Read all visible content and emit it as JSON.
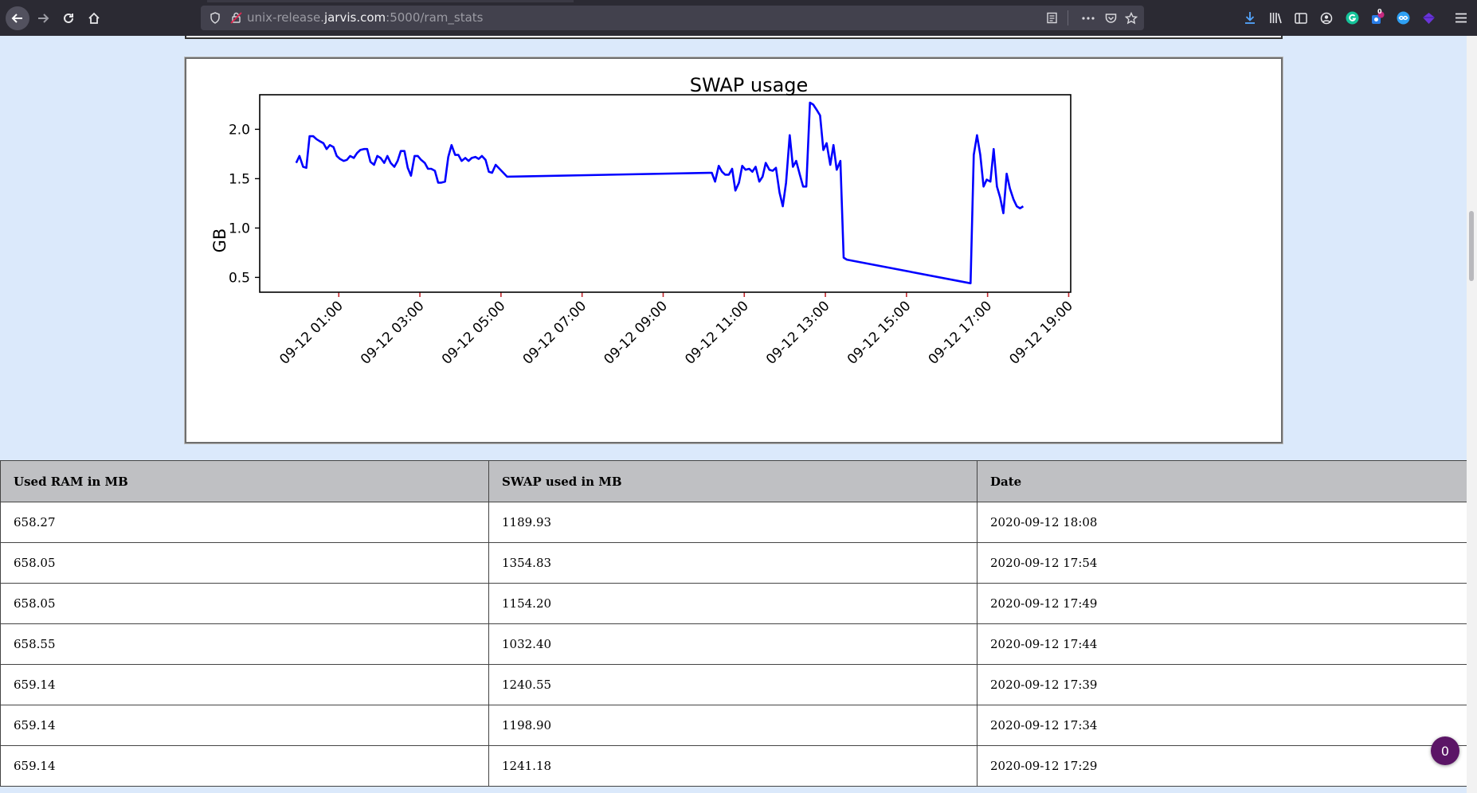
{
  "browser": {
    "url_prefix": "unix-release.",
    "url_domain": "jarvis.com",
    "url_suffix": ":5000/ram_stats",
    "notification_count": "0"
  },
  "colors": {
    "toolbar_bg": "#2b2a33",
    "page_bg": "#dbe9fb",
    "line": "#0000ff",
    "table_header_bg": "#bfc0c3",
    "badge_bg": "#5b1566"
  },
  "chart_data": {
    "type": "line",
    "title": "SWAP usage",
    "ylabel": "GB",
    "xlabel": "",
    "grid": false,
    "ylim": [
      0.35,
      2.35
    ],
    "yticks": [
      0.5,
      1.0,
      1.5,
      2.0
    ],
    "ytick_labels": [
      "0.5",
      "1.0",
      "1.5",
      "2.0"
    ],
    "xlim_hours": [
      -0.95,
      19.05
    ],
    "xtick_labels": [
      "09-12 01:00",
      "09-12 03:00",
      "09-12 05:00",
      "09-12 07:00",
      "09-12 09:00",
      "09-12 11:00",
      "09-12 13:00",
      "09-12 15:00",
      "09-12 17:00",
      "09-12 19:00"
    ],
    "xtick_hours": [
      1,
      3,
      5,
      7,
      9,
      11,
      13,
      15,
      17,
      19
    ],
    "x_hours": [
      -0.05,
      0.03,
      0.12,
      0.2,
      0.28,
      0.37,
      0.45,
      0.53,
      0.62,
      0.7,
      0.78,
      0.87,
      0.95,
      1.03,
      1.12,
      1.2,
      1.28,
      1.37,
      1.45,
      1.53,
      1.62,
      1.7,
      1.78,
      1.87,
      1.95,
      2.03,
      2.12,
      2.2,
      2.28,
      2.37,
      2.45,
      2.53,
      2.62,
      2.7,
      2.78,
      2.87,
      2.95,
      3.03,
      3.12,
      3.2,
      3.28,
      3.37,
      3.45,
      3.53,
      3.62,
      3.7,
      3.78,
      3.87,
      3.95,
      4.03,
      4.12,
      4.2,
      4.28,
      4.37,
      4.45,
      4.53,
      4.62,
      4.7,
      4.78,
      4.87,
      5.15,
      10.2,
      10.28,
      10.37,
      10.45,
      10.53,
      10.62,
      10.7,
      10.78,
      10.87,
      10.95,
      11.03,
      11.12,
      11.2,
      11.28,
      11.37,
      11.45,
      11.53,
      11.62,
      11.7,
      11.78,
      11.87,
      11.95,
      12.03,
      12.12,
      12.2,
      12.28,
      12.37,
      12.45,
      12.53,
      12.62,
      12.7,
      12.78,
      12.87,
      12.95,
      13.03,
      13.12,
      13.2,
      13.28,
      13.37,
      13.45,
      13.53,
      16.58,
      16.66,
      16.74,
      16.82,
      16.9,
      16.98,
      17.07,
      17.15,
      17.23,
      17.31,
      17.39,
      17.47,
      17.55,
      17.64,
      17.72,
      17.8,
      17.88
    ],
    "series": [
      {
        "values": [
          1.66,
          1.73,
          1.62,
          1.61,
          1.93,
          1.93,
          1.9,
          1.88,
          1.86,
          1.8,
          1.84,
          1.82,
          1.73,
          1.7,
          1.68,
          1.69,
          1.73,
          1.71,
          1.76,
          1.79,
          1.8,
          1.8,
          1.67,
          1.64,
          1.73,
          1.71,
          1.66,
          1.73,
          1.66,
          1.62,
          1.68,
          1.78,
          1.78,
          1.61,
          1.53,
          1.73,
          1.73,
          1.69,
          1.66,
          1.6,
          1.6,
          1.58,
          1.46,
          1.46,
          1.47,
          1.72,
          1.84,
          1.74,
          1.74,
          1.68,
          1.71,
          1.68,
          1.71,
          1.72,
          1.7,
          1.73,
          1.69,
          1.57,
          1.56,
          1.64,
          1.52,
          1.56,
          1.47,
          1.63,
          1.57,
          1.54,
          1.54,
          1.6,
          1.38,
          1.46,
          1.63,
          1.59,
          1.6,
          1.57,
          1.62,
          1.47,
          1.52,
          1.66,
          1.59,
          1.58,
          1.61,
          1.36,
          1.22,
          1.46,
          1.94,
          1.62,
          1.68,
          1.54,
          1.42,
          1.42,
          2.27,
          2.25,
          2.2,
          2.14,
          1.79,
          1.86,
          1.64,
          1.84,
          1.59,
          1.68,
          0.7,
          0.68,
          0.44,
          1.74,
          1.94,
          1.74,
          1.42,
          1.49,
          1.47,
          1.8,
          1.42,
          1.31,
          1.15,
          1.55,
          1.4,
          1.29,
          1.22,
          1.2,
          1.22,
          1.02,
          1.16,
          1.33,
          1.17
        ]
      }
    ]
  },
  "table": {
    "headers": [
      "Used RAM in MB",
      "SWAP used in MB",
      "Date"
    ],
    "rows": [
      [
        "658.27",
        "1189.93",
        "2020-09-12 18:08"
      ],
      [
        "658.05",
        "1354.83",
        "2020-09-12 17:54"
      ],
      [
        "658.05",
        "1154.20",
        "2020-09-12 17:49"
      ],
      [
        "658.55",
        "1032.40",
        "2020-09-12 17:44"
      ],
      [
        "659.14",
        "1240.55",
        "2020-09-12 17:39"
      ],
      [
        "659.14",
        "1198.90",
        "2020-09-12 17:34"
      ],
      [
        "659.14",
        "1241.18",
        "2020-09-12 17:29"
      ]
    ]
  }
}
